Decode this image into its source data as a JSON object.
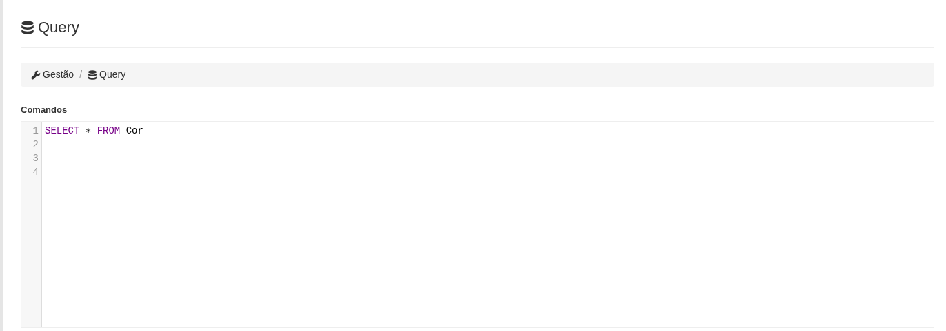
{
  "page_title": {
    "text": "Query",
    "kind": "database"
  },
  "breadcrumb": {
    "separator": "/",
    "items": [
      {
        "label": "Gestão",
        "kind": "wrench"
      },
      {
        "label": "Query",
        "kind": "database"
      }
    ]
  },
  "editor": {
    "label": "Comandos",
    "lines": [
      {
        "number": "1",
        "tokens": [
          {
            "kind": "keyword",
            "text": "SELECT"
          },
          {
            "kind": "plain",
            "text": " ∗ "
          },
          {
            "kind": "keyword",
            "text": "FROM"
          },
          {
            "kind": "plain",
            "text": " Cor"
          }
        ]
      },
      {
        "number": "2"
      },
      {
        "number": "3"
      },
      {
        "number": "4"
      }
    ]
  }
}
